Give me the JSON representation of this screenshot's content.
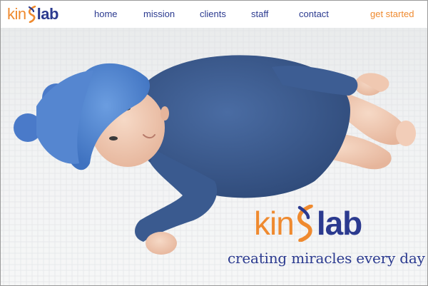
{
  "brand": {
    "logo_kin": "kin",
    "logo_lab": "lab",
    "tagline": "creating miracles every day"
  },
  "nav": {
    "items": [
      {
        "label": "home"
      },
      {
        "label": "mission"
      },
      {
        "label": "clients"
      },
      {
        "label": "staff"
      },
      {
        "label": "contact"
      }
    ],
    "cta_label": "get started"
  },
  "hero": {
    "image_subject": "baby-in-blue-hat-and-onesie"
  },
  "colors": {
    "orange": "#ef8a2f",
    "navy": "#2b3a8f",
    "onesie_blue": "#3f5f93",
    "hat_blue": "#5b8fd6"
  }
}
